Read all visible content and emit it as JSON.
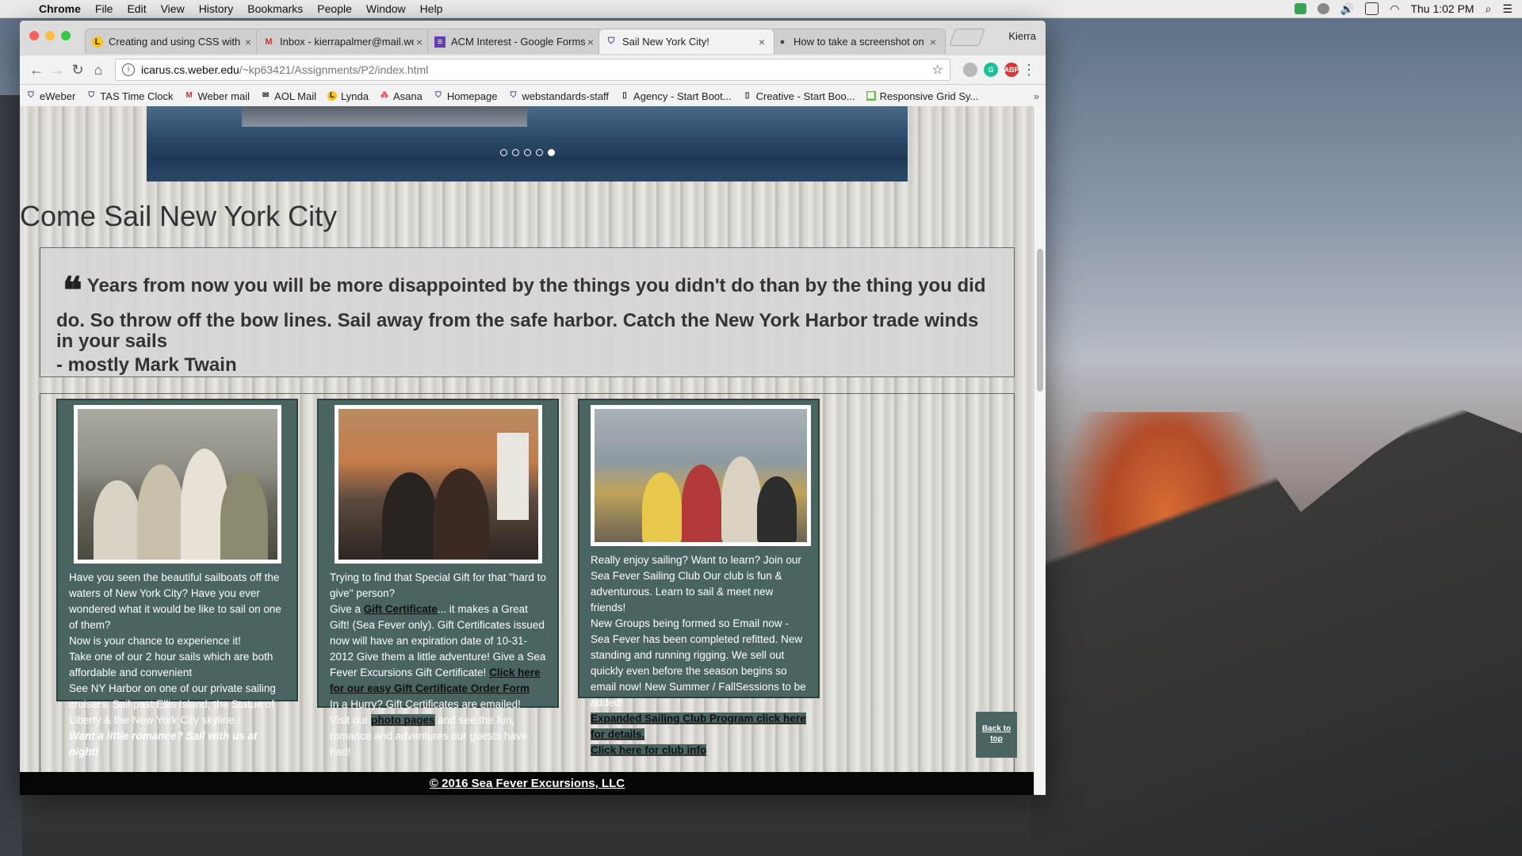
{
  "menubar": {
    "app": "Chrome",
    "items": [
      "File",
      "Edit",
      "View",
      "History",
      "Bookmarks",
      "People",
      "Window",
      "Help"
    ],
    "clock": "Thu 1:02 PM"
  },
  "browser": {
    "profile": "Kierra",
    "tabs": [
      {
        "title": "Creating and using CSS with F",
        "icon": "lynda-icon"
      },
      {
        "title": "Inbox - kierrapalmer@mail.we",
        "icon": "gmail-icon"
      },
      {
        "title": "ACM Interest - Google Forms",
        "icon": "forms-icon"
      },
      {
        "title": "Sail New York City!",
        "icon": "shield-icon"
      },
      {
        "title": "How to take a screenshot on",
        "icon": "apple-icon"
      }
    ],
    "url_host": "icarus.cs.weber.edu",
    "url_path": "/~kp63421/Assignments/P2/index.html",
    "bookmarks": [
      {
        "label": "eWeber",
        "icon": "shield-icon"
      },
      {
        "label": "TAS Time Clock",
        "icon": "shield-icon"
      },
      {
        "label": "Weber mail",
        "icon": "gmail-icon"
      },
      {
        "label": "AOL Mail",
        "icon": "aol-icon"
      },
      {
        "label": "Lynda",
        "icon": "lynda-icon"
      },
      {
        "label": "Asana",
        "icon": "asana-icon"
      },
      {
        "label": "Homepage",
        "icon": "shield-icon"
      },
      {
        "label": "webstandards-staff",
        "icon": "shield-icon"
      },
      {
        "label": "Agency - Start Boot...",
        "icon": "page-icon"
      },
      {
        "label": "Creative - Start Boo...",
        "icon": "page-icon"
      },
      {
        "label": "Responsive Grid Sy...",
        "icon": "grid-icon"
      }
    ],
    "bookmarks_more": "»"
  },
  "page": {
    "heading": "Come Sail New York City",
    "slider": {
      "count": 5,
      "active": 5
    },
    "quote_line1": "Years from now you will be more disappointed by the things you didn't do than by the thing you did",
    "quote_line2": "do. So throw off the bow lines. Sail away from the safe harbor. Catch the New York Harbor trade winds in your sails",
    "quote_attribution": "- mostly Mark Twain",
    "card1": {
      "p1": "Have you seen the beautiful sailboats off the waters of New York City? Have you ever wondered what it would be like to sail on one of them?",
      "p2": "Now is your chance to experience it!",
      "p3": "Take one of our 2 hour sails which are both affordable and convenient",
      "p4": "See NY Harbor on one of our private sailing cruisers. Sail past Ellis Island, the Statue of Liberty & the New York City skyline.",
      "p5": "Want a little romance? Sail with us at night!"
    },
    "card2": {
      "p1": "Trying to find that Special Gift for that \"hard to give\" person?",
      "p2a": "Give a ",
      "p2link": "Gift Certificate",
      "p2b": "... it makes a Great Gift!  (Sea Fever only). Gift Certificates issued now will have an expiration date of 10-31-2012 Give them a little adventure!  Give a Sea Fever Excursions Gift Certificate! ",
      "p2link2": "Click here for our easy Gift Certificate Order Form",
      "p3": "In a Hurry? Gift Certificates are emailed!",
      "p4a": "Visit our ",
      "p4link": "photo pages",
      "p4b": " and see the fun, romance and adventures our guests have had!"
    },
    "card3": {
      "p1": "Really enjoy sailing? Want to learn? Join our Sea Fever Sailing Club Our club is fun & adventurous. Learn to sail & meet new friends!",
      "p2": "New Groups being formed so Email now -   Sea Fever has been completed refitted. New standing and running rigging. We sell out quickly even before the season begins so email now! New Summer / FallSessions to be added!",
      "link1": "Expanded Sailing Club Program click here for details.",
      "link2": "Click here for club info"
    },
    "back_to_top": "Back to top",
    "footer": "© 2016 Sea Fever Excursions, LLC"
  }
}
